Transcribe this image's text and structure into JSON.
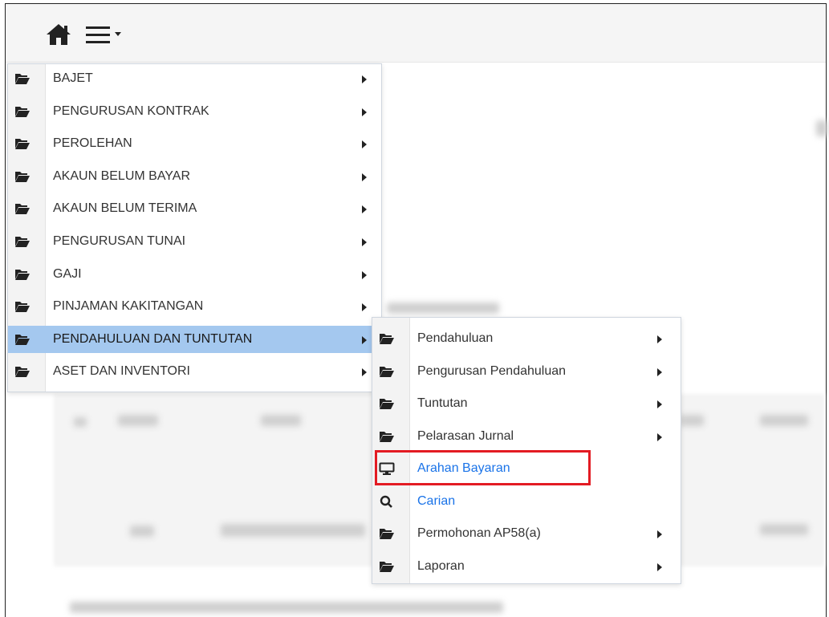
{
  "toolbar": {
    "home_icon": "home-icon",
    "menu_icon": "hamburger-menu-icon"
  },
  "main_menu": {
    "items": [
      {
        "label": "BAJET",
        "icon": "folder-open-icon"
      },
      {
        "label": "PENGURUSAN KONTRAK",
        "icon": "folder-open-icon"
      },
      {
        "label": "PEROLEHAN",
        "icon": "folder-open-icon"
      },
      {
        "label": "AKAUN BELUM BAYAR",
        "icon": "folder-open-icon"
      },
      {
        "label": "AKAUN BELUM TERIMA",
        "icon": "folder-open-icon"
      },
      {
        "label": "PENGURUSAN TUNAI",
        "icon": "folder-open-icon"
      },
      {
        "label": "GAJI",
        "icon": "folder-open-icon"
      },
      {
        "label": "PINJAMAN KAKITANGAN",
        "icon": "folder-open-icon"
      },
      {
        "label": "PENDAHULUAN DAN TUNTUTAN",
        "icon": "folder-open-icon",
        "active": true
      },
      {
        "label": "ASET DAN INVENTORI",
        "icon": "folder-open-icon"
      }
    ]
  },
  "sub_menu": {
    "items": [
      {
        "label": "Pendahuluan",
        "icon": "folder-open-icon"
      },
      {
        "label": "Pengurusan Pendahuluan",
        "icon": "folder-open-icon"
      },
      {
        "label": "Tuntutan",
        "icon": "folder-open-icon"
      },
      {
        "label": "Pelarasan Jurnal",
        "icon": "folder-open-icon"
      },
      {
        "label": "Arahan Bayaran",
        "icon": "monitor-icon",
        "highlighted": true
      },
      {
        "label": "Carian",
        "icon": "search-icon"
      },
      {
        "label": "Permohonan AP58(a)",
        "icon": "folder-open-icon"
      },
      {
        "label": "Laporan",
        "icon": "folder-open-icon"
      }
    ]
  },
  "colors": {
    "active_bg": "#a4c8ef",
    "link": "#1a73e8",
    "highlight_border": "#e31b23"
  }
}
